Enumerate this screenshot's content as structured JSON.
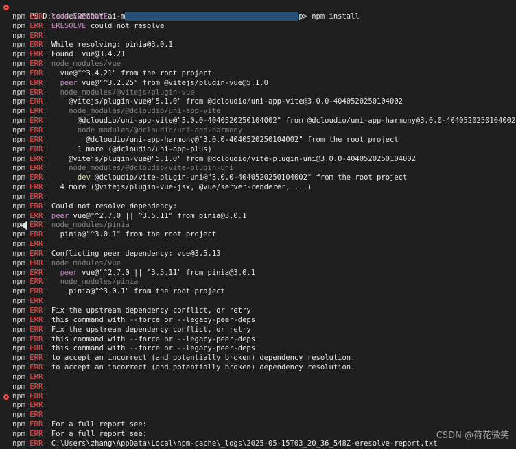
{
  "prompt": {
    "prefix": "PS D:\\code\\wechat-ai-m",
    "hidden": "                                        ",
    "suffix": "p> ",
    "command": "npm install"
  },
  "npm": "npm",
  "err": "ERR!",
  "lines": [
    {
      "t": [
        [
          "code",
          "code ERESOLVE"
        ]
      ]
    },
    {
      "t": [
        [
          "code",
          "ERESOLVE"
        ],
        [
          "bright",
          " could not resolve"
        ]
      ]
    },
    {
      "t": []
    },
    {
      "t": [
        [
          "bright",
          "While resolving: pinia@3.0.1"
        ]
      ]
    },
    {
      "t": [
        [
          "bright",
          "Found: vue@3.4.21"
        ]
      ]
    },
    {
      "t": [
        [
          "dim",
          "node_modules/vue"
        ]
      ]
    },
    {
      "t": [
        [
          "bright",
          "  vue@\"^3.4.21\" from the root project"
        ]
      ]
    },
    {
      "t": [
        [
          "peer",
          "  peer"
        ],
        [
          "bright",
          " vue@\"^3.2.25\" from @vitejs/plugin-vue@5.1.0"
        ]
      ]
    },
    {
      "t": [
        [
          "dim",
          "  node_modules/@vitejs/plugin-vue"
        ]
      ]
    },
    {
      "t": [
        [
          "bright",
          "    @vitejs/plugin-vue@\"5.1.0\" from @dcloudio/uni-app-vite@3.0.0-4040520250104002"
        ]
      ]
    },
    {
      "t": [
        [
          "dim",
          "    node_modules/@dcloudio/uni-app-vite"
        ]
      ]
    },
    {
      "t": [
        [
          "bright",
          "      @dcloudio/uni-app-vite@\"3.0.0-4040520250104002\" from @dcloudio/uni-app-harmony@3.0.0-4040520250104002"
        ]
      ]
    },
    {
      "t": [
        [
          "dim",
          "      node_modules/@dcloudio/uni-app-harmony"
        ]
      ]
    },
    {
      "t": [
        [
          "bright",
          "        @dcloudio/uni-app-harmony@\"3.0.0-4040520250104002\" from the root project"
        ]
      ]
    },
    {
      "t": [
        [
          "bright",
          "      1 more (@dcloudio/uni-app-plus)"
        ]
      ]
    },
    {
      "t": [
        [
          "bright",
          "    @vitejs/plugin-vue@\"5.1.0\" from @dcloudio/vite-plugin-uni@3.0.0-4040520250104002"
        ]
      ]
    },
    {
      "t": [
        [
          "dim",
          "    node_modules/@dcloudio/vite-plugin-uni"
        ]
      ]
    },
    {
      "t": [
        [
          "dev",
          "      dev"
        ],
        [
          "bright",
          " @dcloudio/vite-plugin-uni@\"3.0.0-4040520250104002\" from the root project"
        ]
      ]
    },
    {
      "t": [
        [
          "bright",
          "  4 more (@vitejs/plugin-vue-jsx, @vue/server-renderer, ...)"
        ]
      ]
    },
    {
      "t": []
    },
    {
      "t": [
        [
          "bright",
          "Could not resolve dependency:"
        ]
      ]
    },
    {
      "t": [
        [
          "peer",
          "peer"
        ],
        [
          "bright",
          " vue@\"^2.7.0 || ^3.5.11\" from pinia@3.0.1"
        ]
      ]
    },
    {
      "t": [
        [
          "dim",
          "node_modules/pinia"
        ]
      ]
    },
    {
      "t": [
        [
          "bright",
          "  pinia@\"^3.0.1\" from the root project"
        ]
      ]
    },
    {
      "t": []
    },
    {
      "t": [
        [
          "bright",
          "Conflicting peer dependency: vue@3.5.13"
        ]
      ]
    },
    {
      "t": [
        [
          "dim",
          "node_modules/vue"
        ]
      ]
    },
    {
      "t": [
        [
          "peer",
          "  peer"
        ],
        [
          "bright",
          " vue@\"^2.7.0 || ^3.5.11\" from pinia@3.0.1"
        ]
      ]
    },
    {
      "t": [
        [
          "dim",
          "  node_modules/pinia"
        ]
      ]
    },
    {
      "t": [
        [
          "bright",
          "    pinia@\"^3.0.1\" from the root project"
        ]
      ]
    },
    {
      "t": []
    },
    {
      "t": [
        [
          "bright",
          "Fix the upstream dependency conflict, or retry"
        ]
      ]
    },
    {
      "t": [
        [
          "bright",
          "this command with --force or --legacy-peer-deps"
        ]
      ]
    },
    {
      "t": [
        [
          "bright",
          "Fix the upstream dependency conflict, or retry"
        ]
      ]
    },
    {
      "t": [
        [
          "bright",
          "this command with --force or --legacy-peer-deps"
        ]
      ]
    },
    {
      "t": [
        [
          "bright",
          "this command with --force or --legacy-peer-deps"
        ]
      ]
    },
    {
      "t": [
        [
          "bright",
          "to accept an incorrect (and potentially broken) dependency resolution."
        ]
      ]
    },
    {
      "t": [
        [
          "bright",
          "to accept an incorrect (and potentially broken) dependency resolution."
        ]
      ]
    },
    {
      "t": []
    },
    {
      "t": []
    },
    {
      "t": [],
      "marker": true
    },
    {
      "t": []
    },
    {
      "t": []
    },
    {
      "t": [
        [
          "bright",
          "For a full report see:"
        ]
      ]
    },
    {
      "t": [
        [
          "bright",
          "For a full report see:"
        ]
      ]
    },
    {
      "t": [
        [
          "bright",
          "C:\\Users\\zhang\\AppData\\Local\\npm-cache\\_logs\\2025-05-15T03_20_36_548Z-eresolve-report.txt"
        ]
      ]
    }
  ],
  "watermark": "CSDN @荷花微笑",
  "colors": {
    "background": "#1e1e1e",
    "err": "#f14c4c",
    "keyword": "#c586c0",
    "dim": "#808080",
    "text": "#e5e5e5"
  }
}
